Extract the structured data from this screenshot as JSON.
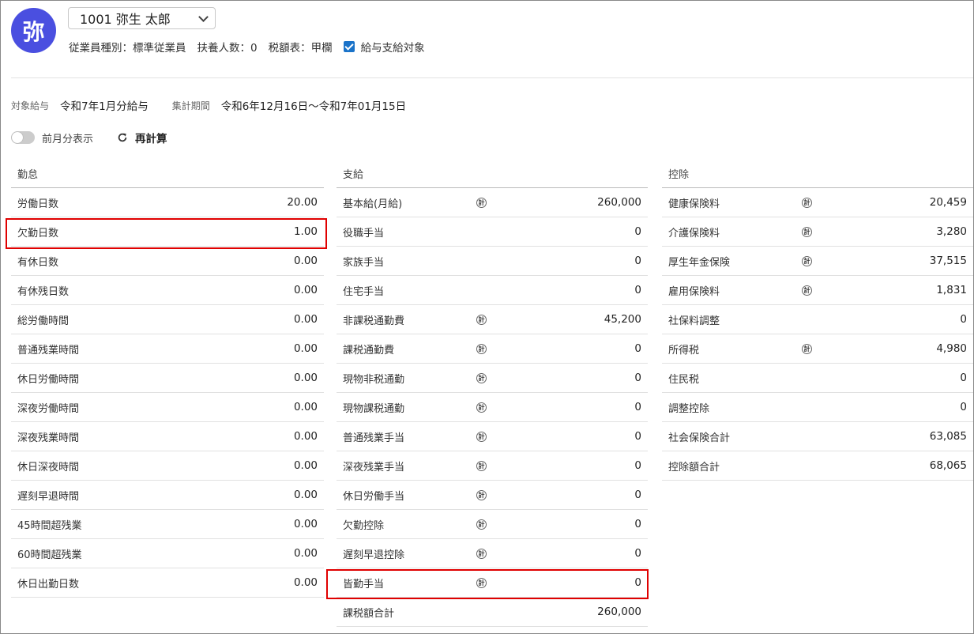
{
  "employee": {
    "avatar_char": "弥",
    "name": "1001 弥生 太郎",
    "type": "従業員種別：標準従業員",
    "dependents": "扶養人数：0",
    "tax_table": "税額表：甲欄",
    "payroll_target_label": "給与支給対象",
    "payroll_target_checked": true
  },
  "period": {
    "target_label": "対象給与",
    "target_value": "令和7年1月分給与",
    "range_label": "集計期間",
    "range_value": "令和6年12月16日〜令和7年01月15日"
  },
  "controls": {
    "prev_month_label": "前月分表示",
    "prev_month_on": false,
    "recalc_label": "再計算"
  },
  "attendance": {
    "header": "勤怠",
    "rows": [
      {
        "label": "労働日数",
        "value": "20.00"
      },
      {
        "label": "欠勤日数",
        "value": "1.00"
      },
      {
        "label": "有休日数",
        "value": "0.00"
      },
      {
        "label": "有休残日数",
        "value": "0.00"
      },
      {
        "label": "総労働時間",
        "value": "0.00"
      },
      {
        "label": "普通残業時間",
        "value": "0.00"
      },
      {
        "label": "休日労働時間",
        "value": "0.00"
      },
      {
        "label": "深夜労働時間",
        "value": "0.00"
      },
      {
        "label": "深夜残業時間",
        "value": "0.00"
      },
      {
        "label": "休日深夜時間",
        "value": "0.00"
      },
      {
        "label": "遅刻早退時間",
        "value": "0.00"
      },
      {
        "label": "45時間超残業",
        "value": "0.00"
      },
      {
        "label": "60時間超残業",
        "value": "0.00"
      },
      {
        "label": "休日出勤日数",
        "value": "0.00"
      }
    ]
  },
  "payments": {
    "header": "支給",
    "icon_char": "計",
    "rows": [
      {
        "label": "基本給(月給)",
        "value": "260,000",
        "icon": true
      },
      {
        "label": "役職手当",
        "value": "0",
        "icon": false
      },
      {
        "label": "家族手当",
        "value": "0",
        "icon": false
      },
      {
        "label": "住宅手当",
        "value": "0",
        "icon": false
      },
      {
        "label": "非課税通勤費",
        "value": "45,200",
        "icon": true
      },
      {
        "label": "課税通勤費",
        "value": "0",
        "icon": true
      },
      {
        "label": "現物非税通勤",
        "value": "0",
        "icon": true
      },
      {
        "label": "現物課税通勤",
        "value": "0",
        "icon": true
      },
      {
        "label": "普通残業手当",
        "value": "0",
        "icon": true
      },
      {
        "label": "深夜残業手当",
        "value": "0",
        "icon": true
      },
      {
        "label": "休日労働手当",
        "value": "0",
        "icon": true
      },
      {
        "label": "欠勤控除",
        "value": "0",
        "icon": true
      },
      {
        "label": "遅刻早退控除",
        "value": "0",
        "icon": true
      },
      {
        "label": "皆勤手当",
        "value": "0",
        "icon": true
      },
      {
        "label": "課税額合計",
        "value": "260,000",
        "icon": false
      }
    ]
  },
  "deductions": {
    "header": "控除",
    "icon_char": "計",
    "rows": [
      {
        "label": "健康保険料",
        "value": "20,459",
        "icon": true
      },
      {
        "label": "介護保険料",
        "value": "3,280",
        "icon": true
      },
      {
        "label": "厚生年金保険",
        "value": "37,515",
        "icon": true
      },
      {
        "label": "雇用保険料",
        "value": "1,831",
        "icon": true
      },
      {
        "label": "社保料調整",
        "value": "0",
        "icon": false
      },
      {
        "label": "所得税",
        "value": "4,980",
        "icon": true
      },
      {
        "label": "住民税",
        "value": "0",
        "icon": false
      },
      {
        "label": "調整控除",
        "value": "0",
        "icon": false
      },
      {
        "label": "社会保険合計",
        "value": "63,085",
        "icon": false
      },
      {
        "label": "控除額合計",
        "value": "68,065",
        "icon": false
      }
    ]
  },
  "colors": {
    "accent": "#4a4fe0",
    "checkbox": "#1a73c9",
    "highlight": "#e00000"
  }
}
